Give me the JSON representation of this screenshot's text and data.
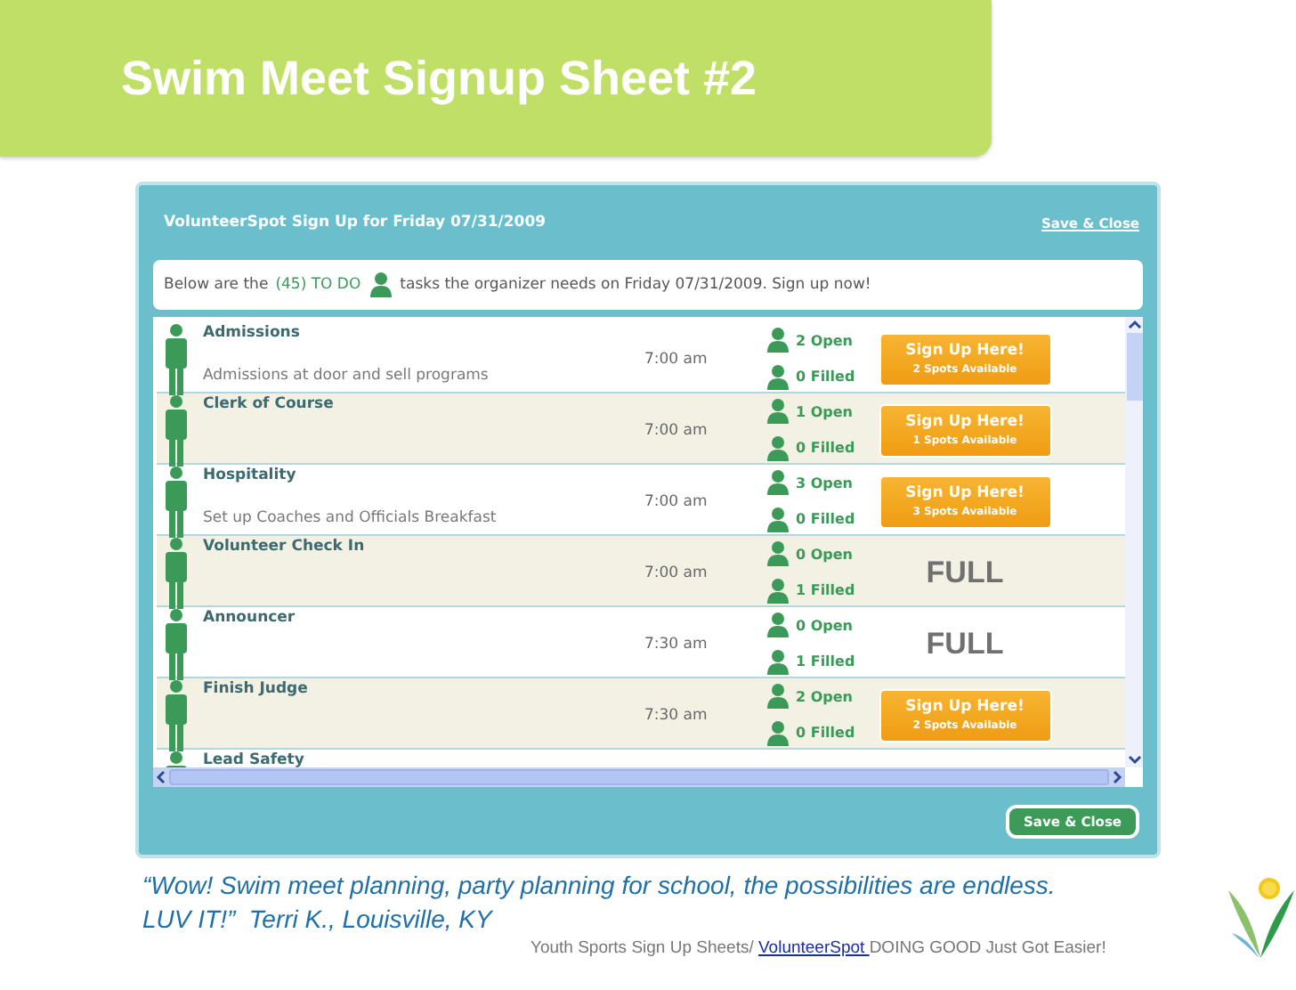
{
  "slide": {
    "title": "Swim Meet Signup Sheet #2"
  },
  "dialog": {
    "title": "VolunteerSpot Sign Up for Friday 07/31/2009",
    "close_link": "Save & Close",
    "intro_lead": "Below are the",
    "intro_count": "(45) TO DO",
    "intro_rest": "tasks the organizer needs on Friday 07/31/2009. Sign up now!",
    "save_button": "Save & Close"
  },
  "rows": [
    {
      "name": "Admissions",
      "description": "Admissions at door and sell programs",
      "time": "7:00 am",
      "open": "2 Open",
      "filled": "0 Filled",
      "action": {
        "kind": "signup",
        "label": "Sign Up Here!",
        "detail": "2 Spots Available"
      }
    },
    {
      "name": "Clerk of Course",
      "time": "7:00 am",
      "open": "1 Open",
      "filled": "0 Filled",
      "action": {
        "kind": "signup",
        "label": "Sign Up Here!",
        "detail": "1 Spots Available"
      }
    },
    {
      "name": "Hospitality",
      "description": "Set up Coaches and Officials Breakfast",
      "time": "7:00 am",
      "open": "3 Open",
      "filled": "0 Filled",
      "action": {
        "kind": "signup",
        "label": "Sign Up Here!",
        "detail": "3 Spots Available"
      }
    },
    {
      "name": "Volunteer Check In",
      "time": "7:00 am",
      "open": "0 Open",
      "filled": "1 Filled",
      "action": {
        "kind": "full",
        "label": "FULL"
      }
    },
    {
      "name": "Announcer",
      "time": "7:30 am",
      "open": "0 Open",
      "filled": "1 Filled",
      "action": {
        "kind": "full",
        "label": "FULL"
      }
    },
    {
      "name": "Finish Judge",
      "time": "7:30 am",
      "open": "2 Open",
      "filled": "0 Filled",
      "action": {
        "kind": "signup",
        "label": "Sign Up Here!",
        "detail": "2 Spots Available"
      }
    },
    {
      "name": "Lead Safety"
    }
  ],
  "footer": {
    "quote": "“Wow! Swim meet planning, party planning for school, the possibilities are endless. LUV IT!”  Terri K., Louisville, KY",
    "tagline_before": "Youth Sports Sign Up Sheets/ ",
    "tagline_link": "VolunteerSpot ",
    "tagline_after": "DOING GOOD Just Got Easier!"
  }
}
